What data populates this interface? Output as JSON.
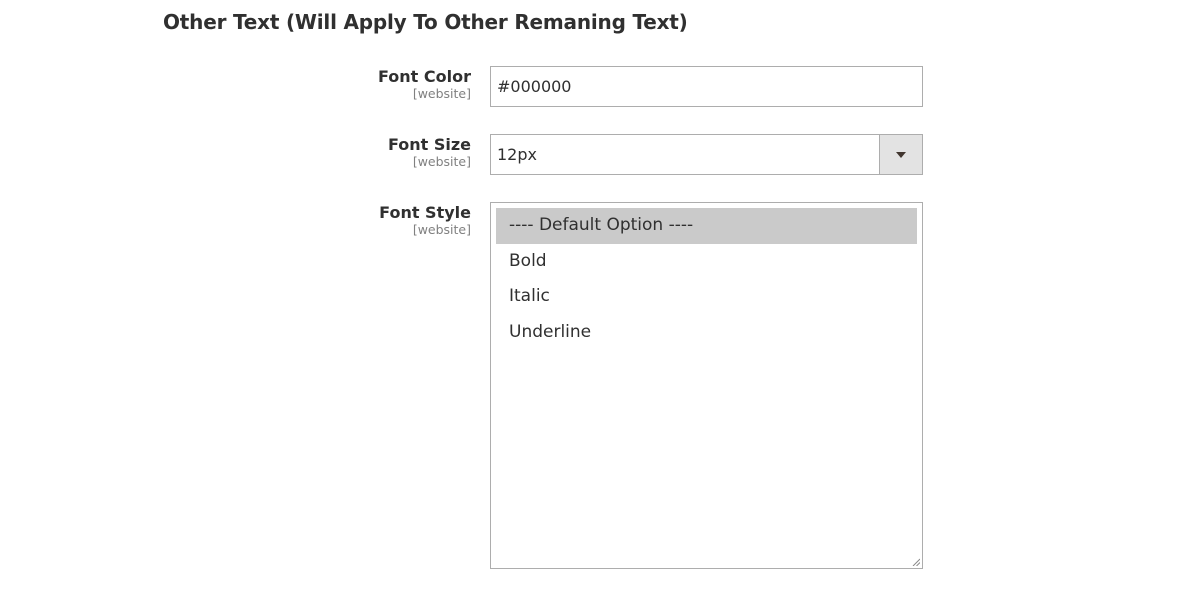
{
  "section": {
    "title": "Other Text (Will Apply To Other Remaning Text)"
  },
  "fields": {
    "font_color": {
      "label": "Font Color",
      "scope": "[website]",
      "value": "#000000"
    },
    "font_size": {
      "label": "Font Size",
      "scope": "[website]",
      "selected": "12px"
    },
    "font_style": {
      "label": "Font Style",
      "scope": "[website]",
      "options": [
        {
          "label": "---- Default Option ----",
          "selected": true
        },
        {
          "label": "Bold",
          "selected": false
        },
        {
          "label": "Italic",
          "selected": false
        },
        {
          "label": "Underline",
          "selected": false
        }
      ]
    }
  },
  "icons": {
    "select_arrow": "chevron-down-icon",
    "resize": "resize-grip-icon"
  },
  "colors": {
    "text": "#303030",
    "scope_text": "#808080",
    "border": "#adadad",
    "selected_option_bg": "#cacaca",
    "select_arrow_bg": "#e3e3e3"
  }
}
